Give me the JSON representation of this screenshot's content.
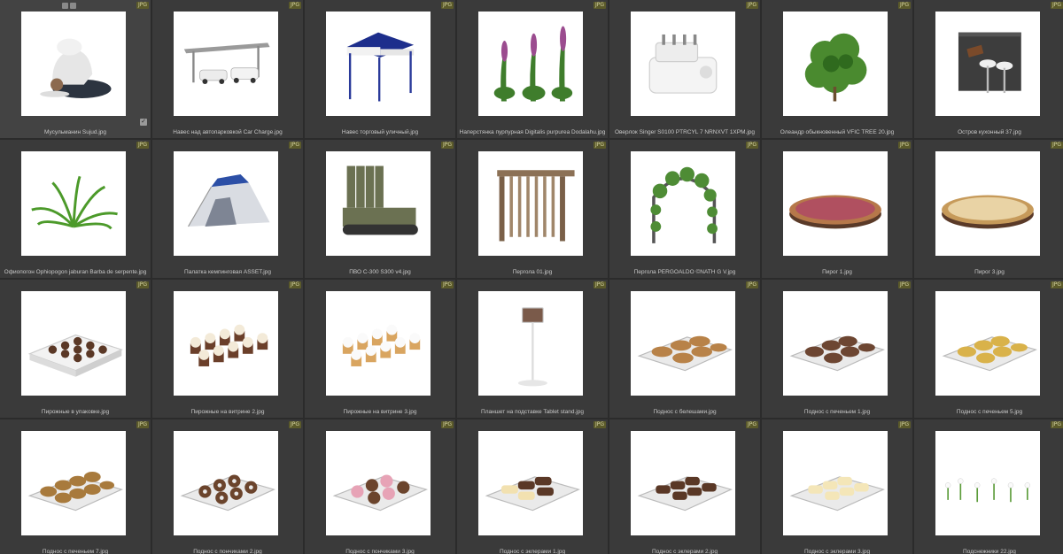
{
  "badge_label": "JPG",
  "items": [
    {
      "caption": "Мусульманин Sujud.jpg",
      "thumb": "person-icon"
    },
    {
      "caption": "Навес над автопарковкой Car Charge.jpg",
      "thumb": "carport-icon"
    },
    {
      "caption": "Навес торговый уличный.jpg",
      "thumb": "tent-canopy-icon"
    },
    {
      "caption": "Наперстянка пурпурная Digitalis purpurea Dodalahu.jpg",
      "thumb": "flower-icon"
    },
    {
      "caption": "Оверлок Singer S0100 PTRCYL 7 NRNXVT 1XPM.jpg",
      "thumb": "sewing-machine-icon"
    },
    {
      "caption": "Олеандр обыкновенный VFIC TREE 20.jpg",
      "thumb": "shrub-icon"
    },
    {
      "caption": "Остров кухонный 37.jpg",
      "thumb": "kitchen-island-icon"
    },
    {
      "caption": "Офиопогон Ophiopogon jaburan Barba de serpente.jpg",
      "thumb": "grass-icon"
    },
    {
      "caption": "Палатка кемпинговая ASSET.jpg",
      "thumb": "camping-tent-icon"
    },
    {
      "caption": "ПВО С-300 S300 v4.jpg",
      "thumb": "military-vehicle-icon"
    },
    {
      "caption": "Пергола 01.jpg",
      "thumb": "pergola-icon"
    },
    {
      "caption": "Пергола PERGOALDO ©NATH G V.jpg",
      "thumb": "arch-icon"
    },
    {
      "caption": "Пирог 1.jpg",
      "thumb": "pie-icon"
    },
    {
      "caption": "Пирог 3.jpg",
      "thumb": "pie-light-icon"
    },
    {
      "caption": "Пирожные в упаковке.jpg",
      "thumb": "pastry-box-icon"
    },
    {
      "caption": "Пирожные на витрине 2.jpg",
      "thumb": "cupcakes-dark-icon"
    },
    {
      "caption": "Пирожные на витрине 3.jpg",
      "thumb": "cupcakes-light-icon"
    },
    {
      "caption": "Планшет на подставке Tablet stand.jpg",
      "thumb": "tablet-stand-icon"
    },
    {
      "caption": "Поднос с белешами.jpg",
      "thumb": "tray-buns-icon"
    },
    {
      "caption": "Поднос с печеньем 1.jpg",
      "thumb": "tray-cookies-dark-icon"
    },
    {
      "caption": "Поднос с печеньем 5.jpg",
      "thumb": "tray-cookies-yellow-icon"
    },
    {
      "caption": "Поднос с печеньем 7.jpg",
      "thumb": "tray-cookies-brown-icon"
    },
    {
      "caption": "Поднос с пончиками 2.jpg",
      "thumb": "tray-donuts-icon"
    },
    {
      "caption": "Поднос с пончиками 3.jpg",
      "thumb": "tray-donuts-pink-icon"
    },
    {
      "caption": "Поднос с эклерами 1.jpg",
      "thumb": "tray-eclairs-icon"
    },
    {
      "caption": "Поднос с эклерами 2.jpg",
      "thumb": "tray-eclairs-dark-icon"
    },
    {
      "caption": "Поднос с эклерами 3.jpg",
      "thumb": "tray-eclairs-light-icon"
    },
    {
      "caption": "Подснежники 22.jpg",
      "thumb": "snowdrops-icon"
    }
  ]
}
